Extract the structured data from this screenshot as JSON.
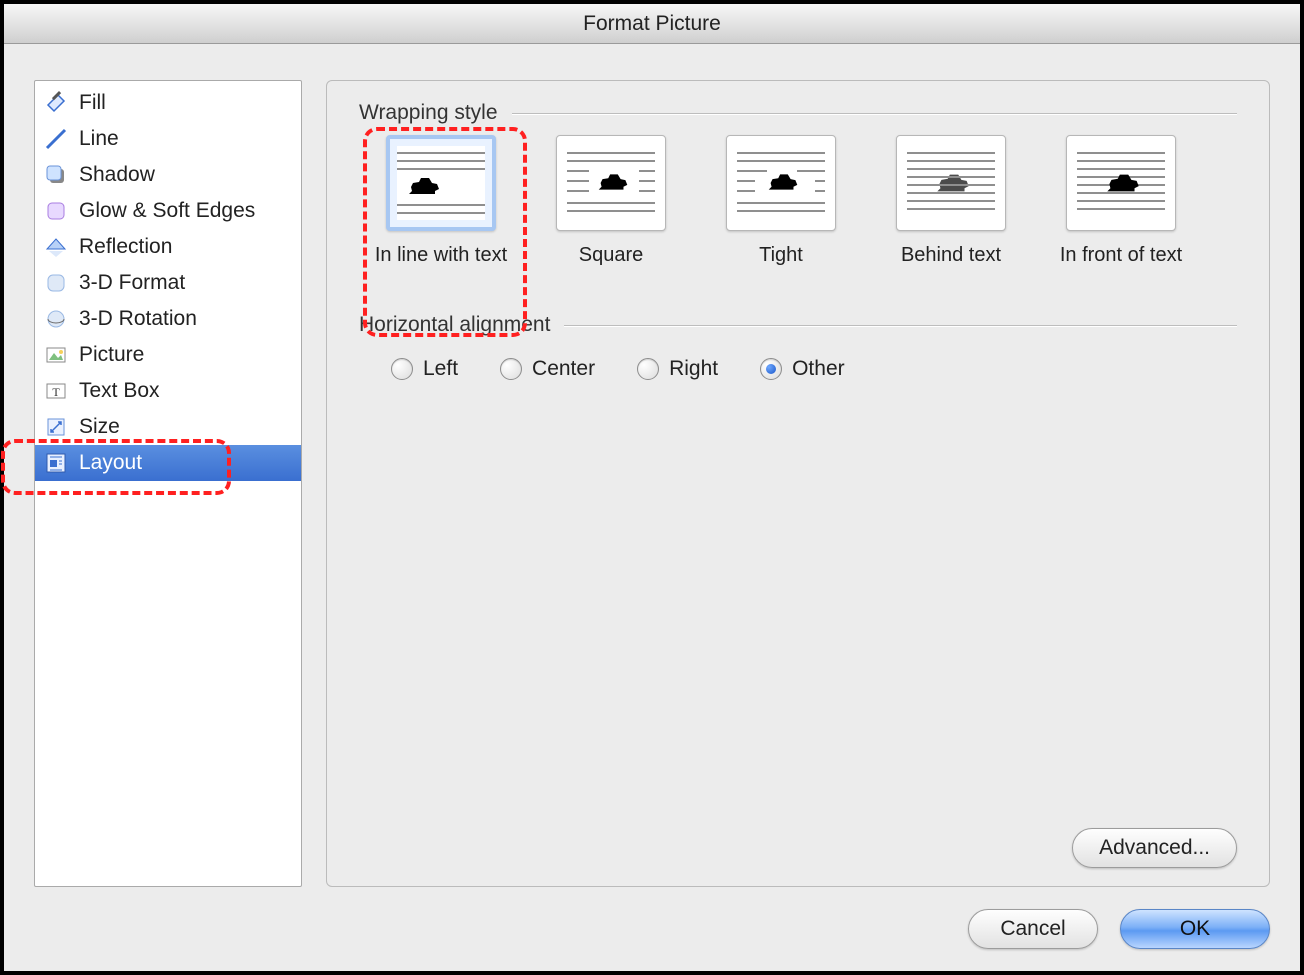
{
  "window": {
    "title": "Format Picture"
  },
  "sidebar": {
    "items": [
      {
        "label": "Fill",
        "icon": "fill-icon"
      },
      {
        "label": "Line",
        "icon": "line-icon"
      },
      {
        "label": "Shadow",
        "icon": "shadow-icon"
      },
      {
        "label": "Glow & Soft Edges",
        "icon": "glow-icon"
      },
      {
        "label": "Reflection",
        "icon": "reflection-icon"
      },
      {
        "label": "3-D Format",
        "icon": "3d-format-icon"
      },
      {
        "label": "3-D Rotation",
        "icon": "3d-rotation-icon"
      },
      {
        "label": "Picture",
        "icon": "picture-icon"
      },
      {
        "label": "Text Box",
        "icon": "textbox-icon"
      },
      {
        "label": "Size",
        "icon": "size-icon"
      },
      {
        "label": "Layout",
        "icon": "layout-icon"
      }
    ],
    "selected": "Layout"
  },
  "sections": {
    "wrapping": {
      "title": "Wrapping style",
      "options": [
        {
          "label": "In line with text",
          "kind": "inline",
          "selected": true
        },
        {
          "label": "Square",
          "kind": "square"
        },
        {
          "label": "Tight",
          "kind": "tight"
        },
        {
          "label": "Behind text",
          "kind": "behind"
        },
        {
          "label": "In front of text",
          "kind": "front"
        }
      ]
    },
    "halign": {
      "title": "Horizontal alignment",
      "options": [
        "Left",
        "Center",
        "Right",
        "Other"
      ],
      "selected": "Other"
    }
  },
  "buttons": {
    "advanced": "Advanced...",
    "cancel": "Cancel",
    "ok": "OK"
  }
}
